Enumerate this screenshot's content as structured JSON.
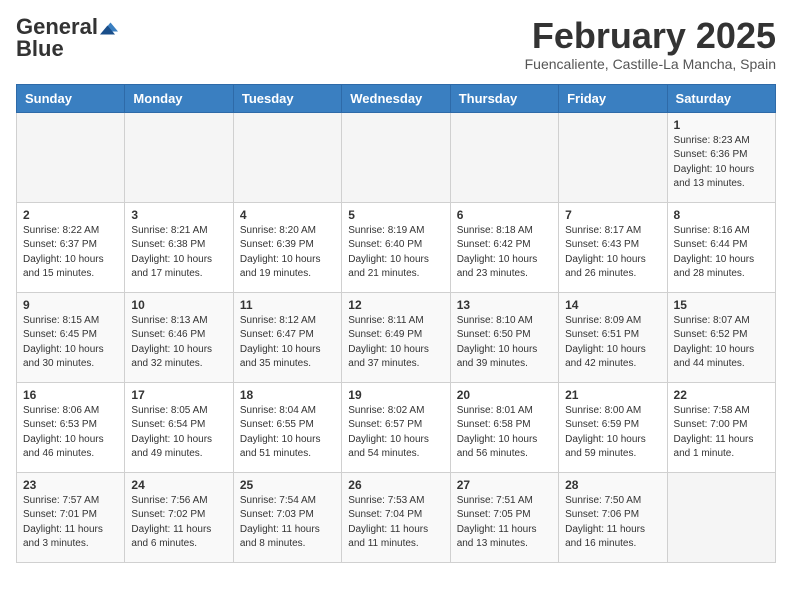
{
  "header": {
    "logo_general": "General",
    "logo_blue": "Blue",
    "month": "February 2025",
    "location": "Fuencaliente, Castille-La Mancha, Spain"
  },
  "weekdays": [
    "Sunday",
    "Monday",
    "Tuesday",
    "Wednesday",
    "Thursday",
    "Friday",
    "Saturday"
  ],
  "weeks": [
    [
      {
        "day": "",
        "info": ""
      },
      {
        "day": "",
        "info": ""
      },
      {
        "day": "",
        "info": ""
      },
      {
        "day": "",
        "info": ""
      },
      {
        "day": "",
        "info": ""
      },
      {
        "day": "",
        "info": ""
      },
      {
        "day": "1",
        "info": "Sunrise: 8:23 AM\nSunset: 6:36 PM\nDaylight: 10 hours\nand 13 minutes."
      }
    ],
    [
      {
        "day": "2",
        "info": "Sunrise: 8:22 AM\nSunset: 6:37 PM\nDaylight: 10 hours\nand 15 minutes."
      },
      {
        "day": "3",
        "info": "Sunrise: 8:21 AM\nSunset: 6:38 PM\nDaylight: 10 hours\nand 17 minutes."
      },
      {
        "day": "4",
        "info": "Sunrise: 8:20 AM\nSunset: 6:39 PM\nDaylight: 10 hours\nand 19 minutes."
      },
      {
        "day": "5",
        "info": "Sunrise: 8:19 AM\nSunset: 6:40 PM\nDaylight: 10 hours\nand 21 minutes."
      },
      {
        "day": "6",
        "info": "Sunrise: 8:18 AM\nSunset: 6:42 PM\nDaylight: 10 hours\nand 23 minutes."
      },
      {
        "day": "7",
        "info": "Sunrise: 8:17 AM\nSunset: 6:43 PM\nDaylight: 10 hours\nand 26 minutes."
      },
      {
        "day": "8",
        "info": "Sunrise: 8:16 AM\nSunset: 6:44 PM\nDaylight: 10 hours\nand 28 minutes."
      }
    ],
    [
      {
        "day": "9",
        "info": "Sunrise: 8:15 AM\nSunset: 6:45 PM\nDaylight: 10 hours\nand 30 minutes."
      },
      {
        "day": "10",
        "info": "Sunrise: 8:13 AM\nSunset: 6:46 PM\nDaylight: 10 hours\nand 32 minutes."
      },
      {
        "day": "11",
        "info": "Sunrise: 8:12 AM\nSunset: 6:47 PM\nDaylight: 10 hours\nand 35 minutes."
      },
      {
        "day": "12",
        "info": "Sunrise: 8:11 AM\nSunset: 6:49 PM\nDaylight: 10 hours\nand 37 minutes."
      },
      {
        "day": "13",
        "info": "Sunrise: 8:10 AM\nSunset: 6:50 PM\nDaylight: 10 hours\nand 39 minutes."
      },
      {
        "day": "14",
        "info": "Sunrise: 8:09 AM\nSunset: 6:51 PM\nDaylight: 10 hours\nand 42 minutes."
      },
      {
        "day": "15",
        "info": "Sunrise: 8:07 AM\nSunset: 6:52 PM\nDaylight: 10 hours\nand 44 minutes."
      }
    ],
    [
      {
        "day": "16",
        "info": "Sunrise: 8:06 AM\nSunset: 6:53 PM\nDaylight: 10 hours\nand 46 minutes."
      },
      {
        "day": "17",
        "info": "Sunrise: 8:05 AM\nSunset: 6:54 PM\nDaylight: 10 hours\nand 49 minutes."
      },
      {
        "day": "18",
        "info": "Sunrise: 8:04 AM\nSunset: 6:55 PM\nDaylight: 10 hours\nand 51 minutes."
      },
      {
        "day": "19",
        "info": "Sunrise: 8:02 AM\nSunset: 6:57 PM\nDaylight: 10 hours\nand 54 minutes."
      },
      {
        "day": "20",
        "info": "Sunrise: 8:01 AM\nSunset: 6:58 PM\nDaylight: 10 hours\nand 56 minutes."
      },
      {
        "day": "21",
        "info": "Sunrise: 8:00 AM\nSunset: 6:59 PM\nDaylight: 10 hours\nand 59 minutes."
      },
      {
        "day": "22",
        "info": "Sunrise: 7:58 AM\nSunset: 7:00 PM\nDaylight: 11 hours\nand 1 minute."
      }
    ],
    [
      {
        "day": "23",
        "info": "Sunrise: 7:57 AM\nSunset: 7:01 PM\nDaylight: 11 hours\nand 3 minutes."
      },
      {
        "day": "24",
        "info": "Sunrise: 7:56 AM\nSunset: 7:02 PM\nDaylight: 11 hours\nand 6 minutes."
      },
      {
        "day": "25",
        "info": "Sunrise: 7:54 AM\nSunset: 7:03 PM\nDaylight: 11 hours\nand 8 minutes."
      },
      {
        "day": "26",
        "info": "Sunrise: 7:53 AM\nSunset: 7:04 PM\nDaylight: 11 hours\nand 11 minutes."
      },
      {
        "day": "27",
        "info": "Sunrise: 7:51 AM\nSunset: 7:05 PM\nDaylight: 11 hours\nand 13 minutes."
      },
      {
        "day": "28",
        "info": "Sunrise: 7:50 AM\nSunset: 7:06 PM\nDaylight: 11 hours\nand 16 minutes."
      },
      {
        "day": "",
        "info": ""
      }
    ]
  ]
}
